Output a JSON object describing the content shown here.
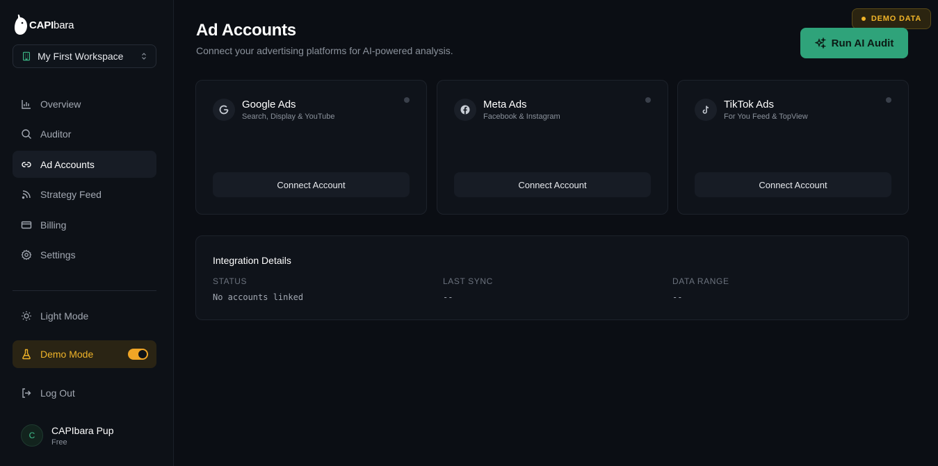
{
  "sidebar": {
    "logo": {
      "bold": "CAPI",
      "light": "bara"
    },
    "workspace": "My First Workspace",
    "nav": [
      {
        "label": "Overview"
      },
      {
        "label": "Auditor"
      },
      {
        "label": "Ad Accounts"
      },
      {
        "label": "Strategy Feed"
      },
      {
        "label": "Billing"
      },
      {
        "label": "Settings"
      }
    ],
    "light_mode": "Light Mode",
    "demo_mode": {
      "label": "Demo Mode",
      "enabled": true
    },
    "logout": "Log Out",
    "user": {
      "initial": "C",
      "name": "CAPIbara Pup",
      "plan": "Free"
    }
  },
  "header": {
    "title": "Ad Accounts",
    "subtitle": "Connect your advertising platforms for AI-powered analysis.",
    "demo_badge": "DEMO DATA",
    "run_audit": "Run AI Audit"
  },
  "platforms": [
    {
      "name": "Google Ads",
      "desc": "Search, Display & YouTube",
      "action": "Connect Account",
      "icon": "google-icon"
    },
    {
      "name": "Meta Ads",
      "desc": "Facebook & Instagram",
      "action": "Connect Account",
      "icon": "facebook-icon"
    },
    {
      "name": "TikTok Ads",
      "desc": "For You Feed & TopView",
      "action": "Connect Account",
      "icon": "tiktok-icon"
    }
  ],
  "integration": {
    "title": "Integration Details",
    "status": {
      "label": "STATUS",
      "value": "No accounts linked"
    },
    "last_sync": {
      "label": "LAST SYNC",
      "value": "--"
    },
    "data_range": {
      "label": "DATA RANGE",
      "value": "--"
    }
  },
  "colors": {
    "accent": "#2fa37a",
    "warning": "#f0b429",
    "background": "#0b0e14"
  }
}
